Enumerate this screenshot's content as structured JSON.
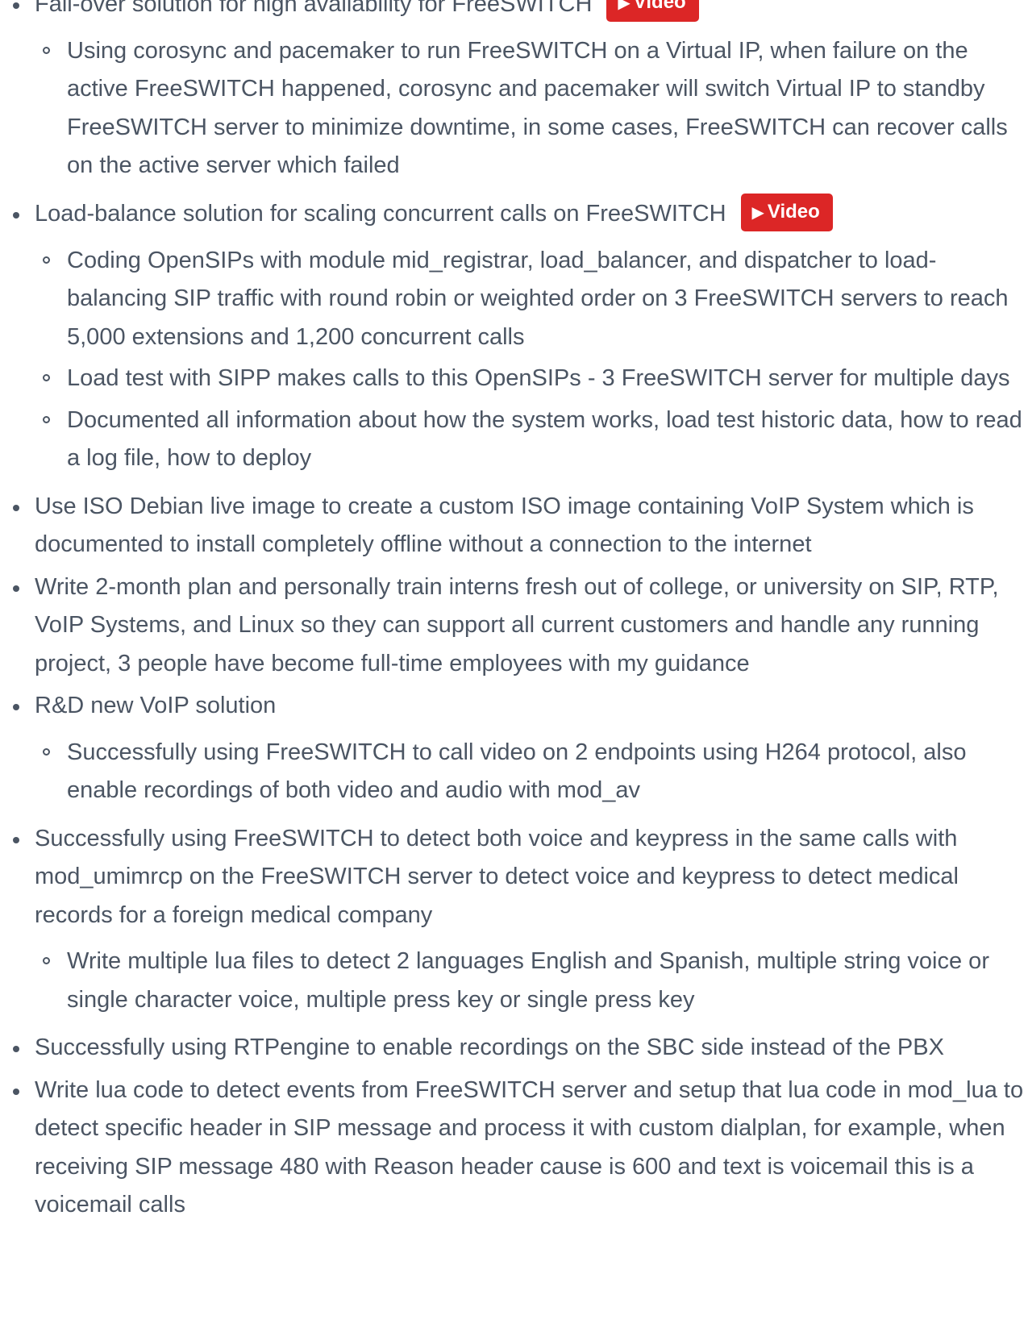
{
  "video_button": {
    "label": "Video",
    "icon": "play-icon",
    "icon_glyph": "▶",
    "color": "#dc2626"
  },
  "items": [
    {
      "text": "Fail-over solution for high availability for FreeSWITCH",
      "has_video": true,
      "sub": [
        "Using corosync and pacemaker to run FreeSWITCH on a Virtual IP, when failure on the active FreeSWITCH happened, corosync and pacemaker will switch Virtual IP to standby FreeSWITCH server to minimize downtime, in some cases, FreeSWITCH can recover calls on the active server which failed"
      ]
    },
    {
      "text": "Load-balance solution for scaling concurrent calls on FreeSWITCH",
      "has_video": true,
      "sub": [
        "Coding OpenSIPs with module mid_registrar, load_balancer, and dispatcher to load-balancing SIP traffic with round robin or weighted order on 3 FreeSWITCH servers to reach 5,000 extensions and 1,200 concurrent calls",
        "Load test with SIPP makes calls to this OpenSIPs - 3 FreeSWITCH server for multiple days",
        "Documented all information about how the system works, load test historic data, how to read a log file, how to deploy"
      ]
    },
    {
      "text": "Use ISO Debian live image to create a custom ISO image containing VoIP System which is documented to install completely offline without a connection to the internet",
      "has_video": false,
      "sub": []
    },
    {
      "text": "Write 2-month plan and personally train interns fresh out of college, or university on SIP, RTP, VoIP Systems, and Linux so they can support all current customers and handle any running project, 3 people have become full-time employees with my guidance",
      "has_video": false,
      "sub": []
    },
    {
      "text": "R&D new VoIP solution",
      "has_video": false,
      "sub": [
        "Successfully using FreeSWITCH to call video on 2 endpoints using H264 protocol, also enable recordings of both video and audio with mod_av"
      ]
    },
    {
      "text": "Successfully using FreeSWITCH to detect both voice and keypress in the same calls with mod_umimrcp on the FreeSWITCH server to detect voice and keypress to detect medical records for a foreign medical company",
      "has_video": false,
      "sub": [
        "Write multiple lua files to detect 2 languages English and Spanish, multiple string voice or single character voice, multiple press key or single press key"
      ]
    },
    {
      "text": "Successfully using RTPengine to enable recordings on the SBC side instead of the PBX",
      "has_video": false,
      "sub": []
    },
    {
      "text": "Write lua code to detect events from FreeSWITCH server and setup that lua code in mod_lua to detect specific header in SIP message and process it with custom dialplan, for example, when receiving SIP message 480 with Reason header cause is 600 and text is voicemail this is a voicemail calls",
      "has_video": false,
      "sub": []
    }
  ]
}
